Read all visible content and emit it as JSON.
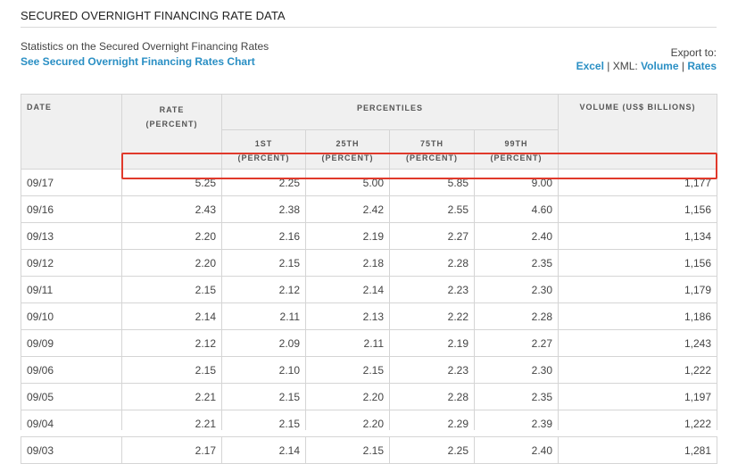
{
  "header": {
    "title": "SECURED OVERNIGHT FINANCING RATE DATA",
    "intro": "Statistics on the Secured Overnight Financing Rates",
    "chart_link": "See Secured Overnight Financing Rates Chart"
  },
  "export": {
    "label": "Export to:",
    "excel": "Excel",
    "separator1": " | XML: ",
    "volume": "Volume",
    "separator2": " | ",
    "rates": "Rates"
  },
  "table": {
    "headers": {
      "date": "DATE",
      "rate": "RATE",
      "rate_unit": "(PERCENT)",
      "percentiles": "PERCENTILES",
      "p1": "1ST",
      "p25": "25TH",
      "p75": "75TH",
      "p99": "99TH",
      "unit": "(PERCENT)",
      "volume": "VOLUME (US$ BILLIONS)"
    },
    "rows": [
      {
        "date": "09/17",
        "rate": "5.25",
        "p1": "2.25",
        "p25": "5.00",
        "p75": "5.85",
        "p99": "9.00",
        "volume": "1,177"
      },
      {
        "date": "09/16",
        "rate": "2.43",
        "p1": "2.38",
        "p25": "2.42",
        "p75": "2.55",
        "p99": "4.60",
        "volume": "1,156"
      },
      {
        "date": "09/13",
        "rate": "2.20",
        "p1": "2.16",
        "p25": "2.19",
        "p75": "2.27",
        "p99": "2.40",
        "volume": "1,134"
      },
      {
        "date": "09/12",
        "rate": "2.20",
        "p1": "2.15",
        "p25": "2.18",
        "p75": "2.28",
        "p99": "2.35",
        "volume": "1,156"
      },
      {
        "date": "09/11",
        "rate": "2.15",
        "p1": "2.12",
        "p25": "2.14",
        "p75": "2.23",
        "p99": "2.30",
        "volume": "1,179"
      },
      {
        "date": "09/10",
        "rate": "2.14",
        "p1": "2.11",
        "p25": "2.13",
        "p75": "2.22",
        "p99": "2.28",
        "volume": "1,186"
      },
      {
        "date": "09/09",
        "rate": "2.12",
        "p1": "2.09",
        "p25": "2.11",
        "p75": "2.19",
        "p99": "2.27",
        "volume": "1,243"
      },
      {
        "date": "09/06",
        "rate": "2.15",
        "p1": "2.10",
        "p25": "2.15",
        "p75": "2.23",
        "p99": "2.30",
        "volume": "1,222"
      },
      {
        "date": "09/05",
        "rate": "2.21",
        "p1": "2.15",
        "p25": "2.20",
        "p75": "2.28",
        "p99": "2.35",
        "volume": "1,197"
      },
      {
        "date": "09/04",
        "rate": "2.21",
        "p1": "2.15",
        "p25": "2.20",
        "p75": "2.29",
        "p99": "2.39",
        "volume": "1,222"
      },
      {
        "date": "09/03",
        "rate": "2.17",
        "p1": "2.14",
        "p25": "2.15",
        "p75": "2.25",
        "p99": "2.40",
        "volume": "1,281"
      }
    ]
  },
  "colors": {
    "link": "#2a8fc4",
    "highlight_border": "#e0392b",
    "header_bg": "#f0f0f0"
  }
}
